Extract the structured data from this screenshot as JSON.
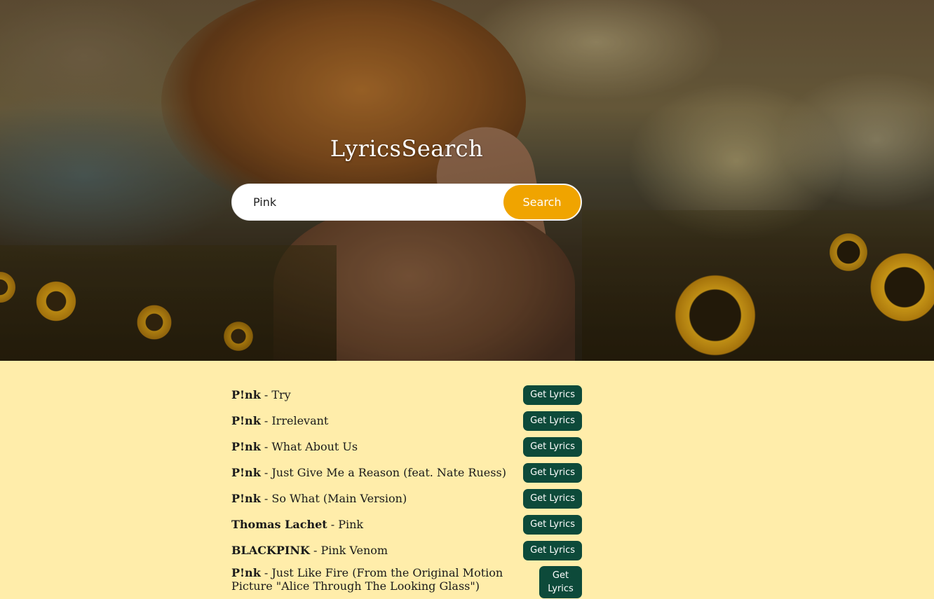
{
  "header": {
    "title": "LyricsSearch"
  },
  "search": {
    "value": "Pink",
    "placeholder": "",
    "button_label": "Search"
  },
  "results": [
    {
      "artist": "P!nk",
      "song": "Try",
      "button_label": "Get Lyrics"
    },
    {
      "artist": "P!nk",
      "song": "Irrelevant",
      "button_label": "Get Lyrics"
    },
    {
      "artist": "P!nk",
      "song": "What About Us",
      "button_label": "Get Lyrics"
    },
    {
      "artist": "P!nk",
      "song": "Just Give Me a Reason (feat. Nate Ruess)",
      "button_label": "Get Lyrics"
    },
    {
      "artist": "P!nk",
      "song": "So What (Main Version)",
      "button_label": "Get Lyrics"
    },
    {
      "artist": "Thomas Lachet",
      "song": "Pink",
      "button_label": "Get Lyrics"
    },
    {
      "artist": "BLACKPINK",
      "song": "Pink Venom",
      "button_label": "Get Lyrics"
    },
    {
      "artist": "P!nk",
      "song": "Just Like Fire (From the Original Motion Picture \"Alice Through The Looking Glass\")",
      "button_label": "Get Lyrics"
    }
  ],
  "separator": " - ",
  "colors": {
    "page_background": "#ffedaa",
    "search_button": "#f0a400",
    "lyrics_button": "#0d4a3a"
  }
}
